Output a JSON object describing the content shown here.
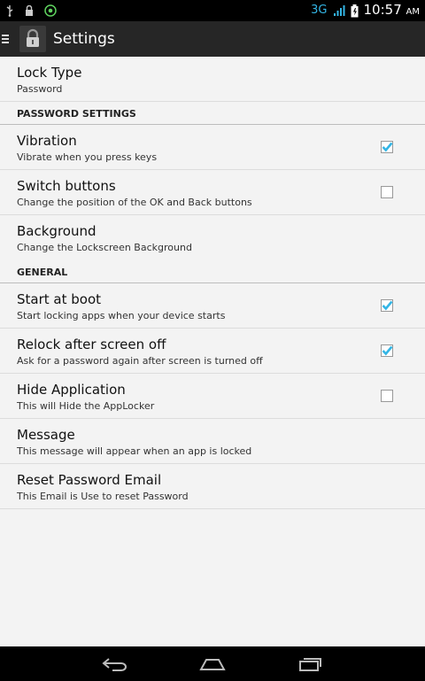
{
  "status_bar": {
    "network": "3G",
    "time": "10:57",
    "ampm": "AM"
  },
  "action_bar": {
    "title": "Settings"
  },
  "sections": {
    "lock_type": {
      "title": "Lock Type",
      "summary": "Password"
    },
    "password_header": "PASSWORD SETTINGS",
    "vibration": {
      "title": "Vibration",
      "summary": "Vibrate when you press keys",
      "checked": true
    },
    "switch_buttons": {
      "title": "Switch buttons",
      "summary": "Change the position of the OK and Back buttons",
      "checked": false
    },
    "background": {
      "title": "Background",
      "summary": "Change the Lockscreen Background"
    },
    "general_header": "GENERAL",
    "start_at_boot": {
      "title": "Start at boot",
      "summary": "Start locking apps when your device starts",
      "checked": true
    },
    "relock": {
      "title": "Relock after screen off",
      "summary": "Ask for a password again after screen is turned off",
      "checked": true
    },
    "hide_app": {
      "title": "Hide Application",
      "summary": "This will Hide the AppLocker",
      "checked": false
    },
    "message": {
      "title": "Message",
      "summary": "This message will appear when an app is locked"
    },
    "reset_email": {
      "title": "Reset Password Email",
      "summary": "This Email is Use to reset Password"
    }
  },
  "colors": {
    "accent": "#33b5e5",
    "action_bar": "#262626",
    "background": "#f3f3f3"
  },
  "icons": {
    "status_left": [
      "usb-icon",
      "lock-icon",
      "android-debug-icon"
    ],
    "status_right": [
      "signal-icon",
      "battery-icon"
    ],
    "nav": [
      "back-icon",
      "home-icon",
      "recent-apps-icon"
    ]
  }
}
